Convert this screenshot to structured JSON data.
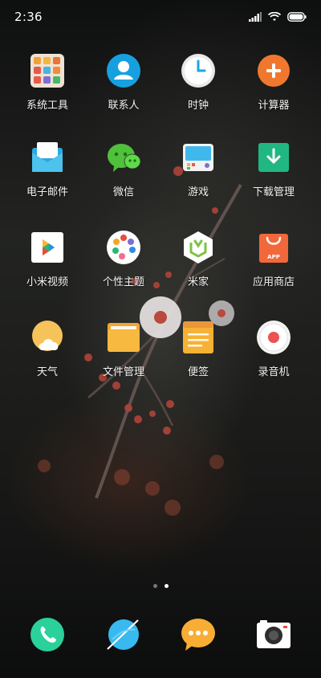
{
  "status_bar": {
    "time": "2:36"
  },
  "apps": [
    {
      "label": "系统工具",
      "icon": "system-tools-icon"
    },
    {
      "label": "联系人",
      "icon": "contacts-icon"
    },
    {
      "label": "时钟",
      "icon": "clock-icon"
    },
    {
      "label": "计算器",
      "icon": "calculator-icon"
    },
    {
      "label": "电子邮件",
      "icon": "email-icon"
    },
    {
      "label": "微信",
      "icon": "wechat-icon"
    },
    {
      "label": "游戏",
      "icon": "games-icon"
    },
    {
      "label": "下载管理",
      "icon": "downloads-icon"
    },
    {
      "label": "小米视频",
      "icon": "mi-video-icon"
    },
    {
      "label": "个性主题",
      "icon": "themes-icon"
    },
    {
      "label": "米家",
      "icon": "mijia-icon"
    },
    {
      "label": "应用商店",
      "icon": "app-store-icon"
    },
    {
      "label": "天气",
      "icon": "weather-icon"
    },
    {
      "label": "文件管理",
      "icon": "file-manager-icon"
    },
    {
      "label": "便签",
      "icon": "notes-icon"
    },
    {
      "label": "录音机",
      "icon": "recorder-icon"
    }
  ],
  "app_store_badge": "APP",
  "page_indicator": {
    "pages": 2,
    "current": 2
  },
  "dock": [
    {
      "icon": "phone-icon"
    },
    {
      "icon": "browser-icon"
    },
    {
      "icon": "messages-icon"
    },
    {
      "icon": "camera-icon"
    }
  ]
}
